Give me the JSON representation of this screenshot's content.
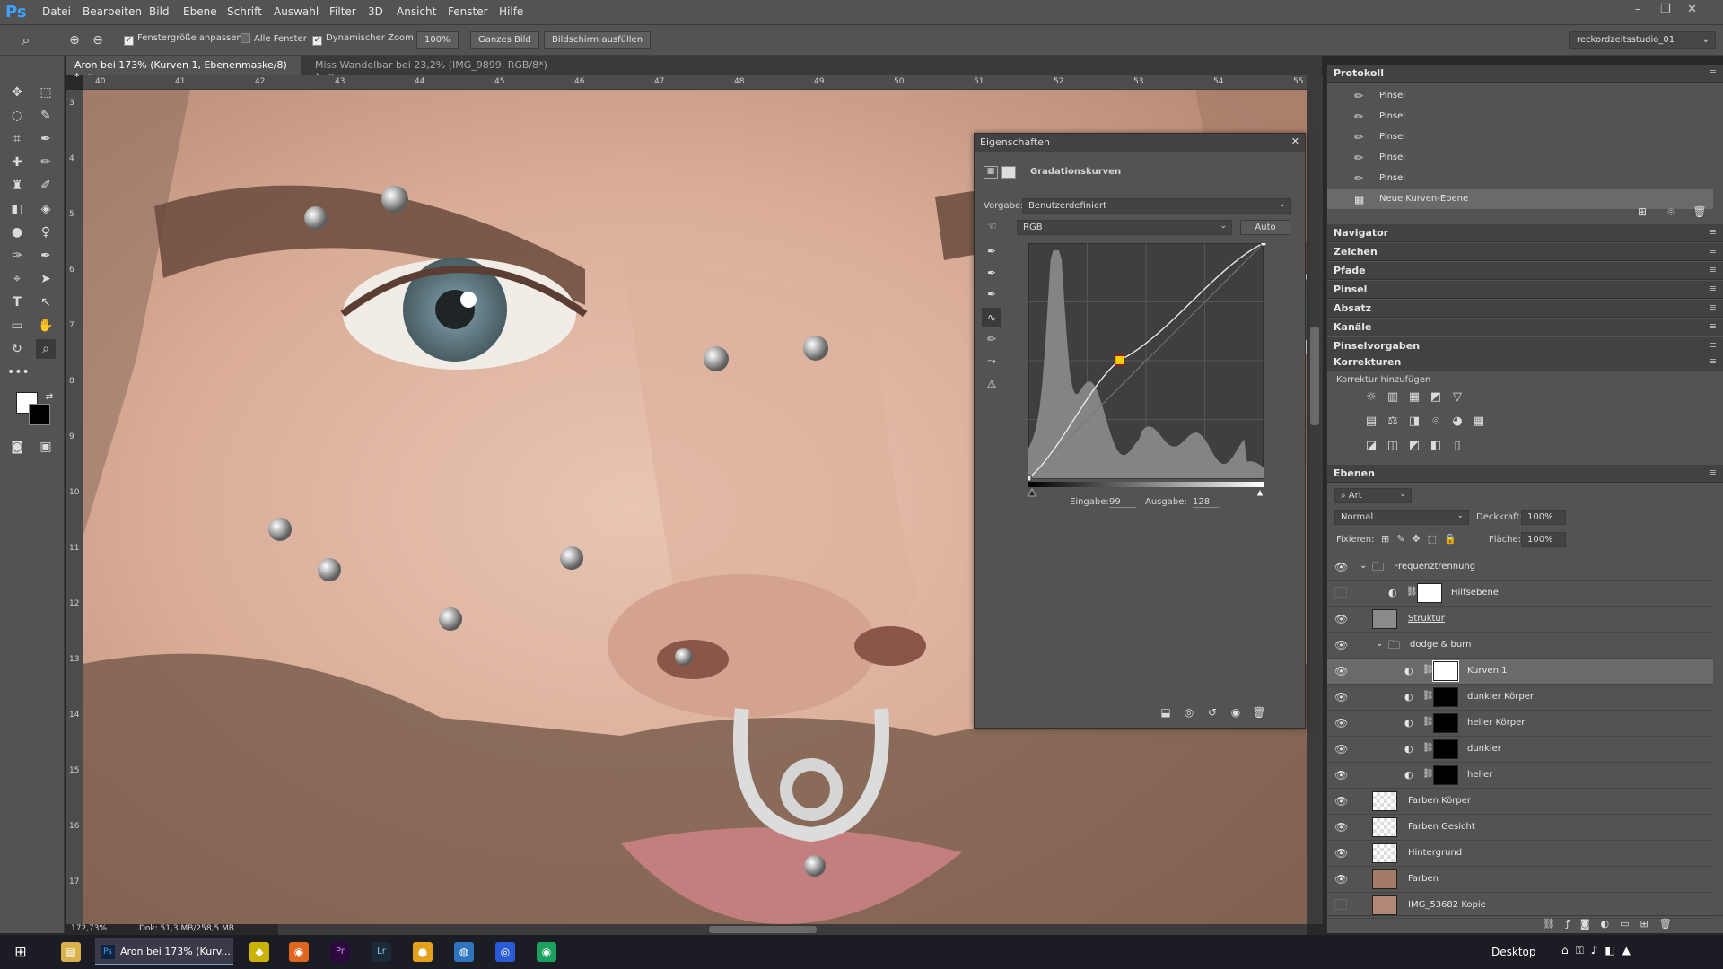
{
  "app": {
    "logo": "Ps"
  },
  "menu": [
    "Datei",
    "Bearbeiten",
    "Bild",
    "Ebene",
    "Schrift",
    "Auswahl",
    "Filter",
    "3D",
    "Ansicht",
    "Fenster",
    "Hilfe"
  ],
  "window_controls": {
    "minimize": "–",
    "restore": "❐",
    "close": "✕"
  },
  "options": {
    "resize_windows_label": "Fenstergröße anpassen",
    "all_windows_label": "Alle Fenster",
    "scrubby_zoom_label": "Dynamischer Zoom",
    "zoom_100": "100%",
    "fit_screen": "Ganzes Bild",
    "fill_screen": "Bildschirm ausfüllen",
    "workspace": "reckordzeitsstudio_01"
  },
  "tabs": [
    {
      "label": "Aron bei 173% (Kurven 1, Ebenenmaske/8) *"
    },
    {
      "label": "Miss Wandelbar bei 23,2% (IMG_9899, RGB/8*) *"
    }
  ],
  "ruler_top": [
    "40",
    "41",
    "42",
    "43",
    "44",
    "45",
    "46",
    "47",
    "48",
    "49",
    "50",
    "51",
    "52",
    "53",
    "54",
    "55"
  ],
  "ruler_left": [
    "3",
    "4",
    "5",
    "6",
    "7",
    "8",
    "9",
    "10",
    "11",
    "12",
    "13",
    "14",
    "15",
    "16",
    "17"
  ],
  "status": {
    "zoom": "172,73%",
    "doc": "Dok: 51,3 MB/258,5 MB"
  },
  "properties": {
    "title": "Eigenschaften",
    "panel_name": "Gradationskurven",
    "preset_label": "Vorgabe:",
    "preset_value": "Benutzerdefiniert",
    "channel": "RGB",
    "auto": "Auto",
    "input_label": "Eingabe:",
    "input_value": "99",
    "output_label": "Ausgabe:",
    "output_value": "128"
  },
  "history": {
    "title": "Protokoll",
    "items": [
      "Pinsel",
      "Pinsel",
      "Pinsel",
      "Pinsel",
      "Pinsel",
      "Neue Kurven-Ebene"
    ]
  },
  "collapsed_panels": [
    "Navigator",
    "Zeichen",
    "Pfade",
    "Pinsel",
    "Absatz",
    "Kanäle",
    "Pinselvorgaben"
  ],
  "corrections": {
    "title": "Korrekturen",
    "add_label": "Korrektur hinzufügen"
  },
  "layers": {
    "title": "Ebenen",
    "filter_kind": "Art",
    "blend_mode": "Normal",
    "opacity_label": "Deckkraft:",
    "opacity_value": "100%",
    "lock_label": "Fixieren:",
    "fill_label": "Fläche:",
    "fill_value": "100%",
    "rows": [
      {
        "name": "Frequenztrennung"
      },
      {
        "name": "Hilfsebene"
      },
      {
        "name": "Struktur"
      },
      {
        "name": "dodge & burn"
      },
      {
        "name": "Kurven 1"
      },
      {
        "name": "dunkler Körper"
      },
      {
        "name": "heller Körper"
      },
      {
        "name": "dunkler"
      },
      {
        "name": "heller"
      },
      {
        "name": "Farben Körper"
      },
      {
        "name": "Farben Gesicht"
      },
      {
        "name": "Hintergrund"
      },
      {
        "name": "Farben"
      },
      {
        "name": "IMG_53682 Kopie"
      }
    ]
  },
  "taskbar": {
    "active_window": "Aron bei 173% (Kurv...",
    "desktop": "Desktop"
  },
  "curve": {
    "points": [
      [
        0,
        0
      ],
      [
        99,
        128
      ],
      [
        255,
        255
      ]
    ],
    "histogram_peak_input": 30
  }
}
